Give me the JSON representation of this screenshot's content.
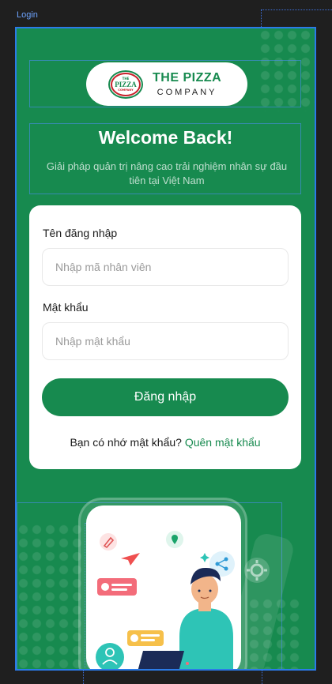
{
  "frame": {
    "label": "Login"
  },
  "brand": {
    "badge_top": "THE",
    "badge_main": "PIZZA",
    "badge_bottom": "COMPANY",
    "name_line1": "THE PIZZA",
    "name_line2": "COMPANY"
  },
  "header": {
    "title": "Welcome Back!",
    "subtitle": "Giải pháp quản trị nâng cao trải nghiệm nhân sự đầu tiên tại Việt Nam"
  },
  "form": {
    "username_label": "Tên đăng nhập",
    "username_placeholder": "Nhập mã nhân viên",
    "username_value": "",
    "password_label": "Mật khẩu",
    "password_placeholder": "Nhập mật khẩu",
    "password_value": "",
    "submit_label": "Đăng nhập",
    "forgot_prompt": "Bạn có nhớ mật khẩu?",
    "forgot_link": "Quên mật khẩu"
  },
  "illustration": {
    "icons": [
      "pencil-icon",
      "location-pin-icon",
      "share-icon",
      "gear-icon",
      "user-icon",
      "paper-plane-icon"
    ]
  },
  "colors": {
    "brand_green": "#178a4f",
    "brand_red": "#c8202a",
    "frame_outline": "#2b7be8",
    "canvas_bg": "#1f1f1f"
  }
}
